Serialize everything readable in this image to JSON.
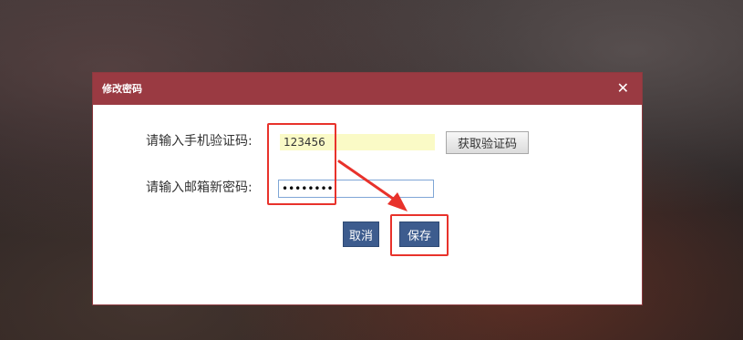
{
  "dialog": {
    "title": "修改密码",
    "close_symbol": "✕"
  },
  "form": {
    "code_label": "请输入手机验证码:",
    "code_value": "123456",
    "get_code_button": "获取验证码",
    "password_label": "请输入邮箱新密码:",
    "password_value": "12345678"
  },
  "actions": {
    "cancel_label": "取消",
    "save_label": "保存"
  },
  "colors": {
    "titlebar": "#9a3a42",
    "button_blue": "#3d5c8e",
    "annotation_red": "#e8322b",
    "code_field_bg": "#fafac6"
  }
}
